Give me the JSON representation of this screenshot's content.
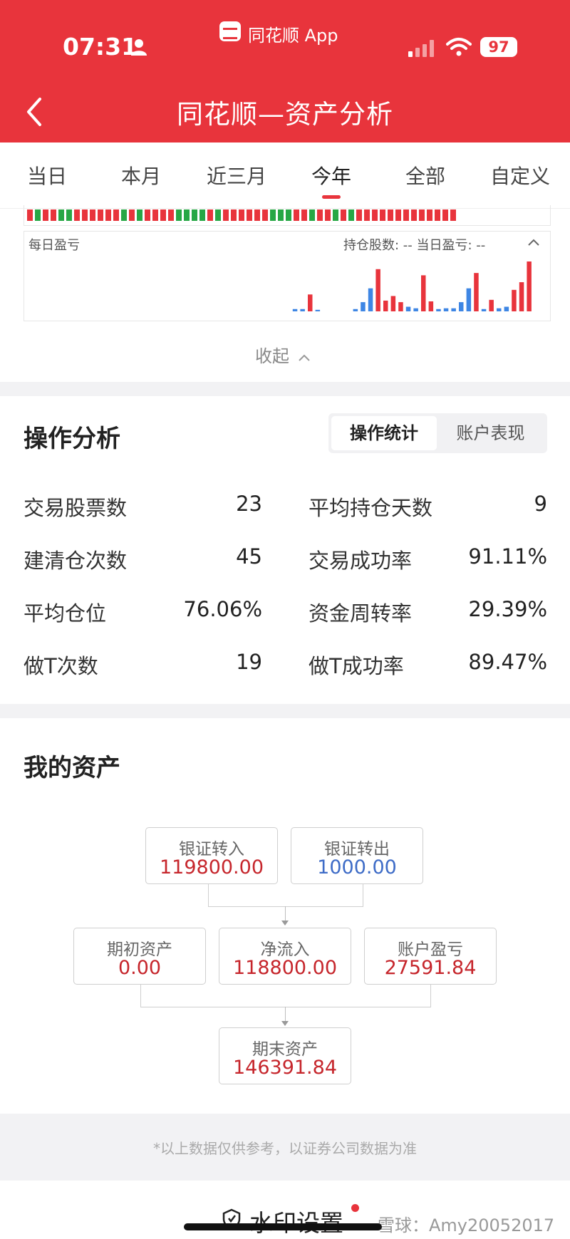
{
  "status_bar": {
    "time": "07:31",
    "app_name": "同花顺 App",
    "battery": "97"
  },
  "header": {
    "title": "同花顺—资产分析"
  },
  "tabs": [
    {
      "label": "当日"
    },
    {
      "label": "本月"
    },
    {
      "label": "近三月"
    },
    {
      "label": "今年"
    },
    {
      "label": "全部"
    },
    {
      "label": "自定义"
    }
  ],
  "active_tab": "今年",
  "daily_chart": {
    "label": "每日盈亏",
    "info": "持仓股数: -- 当日盈亏: --",
    "collapse": "收起",
    "colors": {
      "profit": "#e8343c",
      "loss": "#3e86e4",
      "strip_down": "#27a745"
    }
  },
  "chart_data": {
    "type": "bar",
    "values": [
      0,
      0,
      0,
      0,
      0,
      0,
      0,
      0,
      0,
      0,
      0,
      0,
      0,
      0,
      0,
      0,
      0,
      0,
      -3,
      -3,
      22,
      -2,
      0,
      0,
      0,
      0,
      -3,
      -12,
      -30,
      55,
      14,
      20,
      12,
      -6,
      -4,
      47,
      13,
      -3,
      -4,
      -4,
      -12,
      -30,
      50,
      -3,
      15,
      -4,
      -6,
      28,
      38,
      65
    ]
  },
  "operation_analysis": {
    "title": "操作分析",
    "segments": [
      {
        "label": "操作统计"
      },
      {
        "label": "账户表现"
      }
    ],
    "stats": [
      {
        "label": "交易股票数",
        "value": "23"
      },
      {
        "label": "平均持仓天数",
        "value": "9"
      },
      {
        "label": "建清仓次数",
        "value": "45"
      },
      {
        "label": "交易成功率",
        "value": "91.11%"
      },
      {
        "label": "平均仓位",
        "value": "76.06%"
      },
      {
        "label": "资金周转率",
        "value": "29.39%"
      },
      {
        "label": "做T次数",
        "value": "19"
      },
      {
        "label": "做T成功率",
        "value": "89.47%"
      }
    ]
  },
  "my_assets": {
    "title": "我的资产",
    "bank_in": {
      "label": "银证转入",
      "value": "119800.00"
    },
    "bank_out": {
      "label": "银证转出",
      "value": "1000.00"
    },
    "initial": {
      "label": "期初资产",
      "value": "0.00"
    },
    "net_inflow": {
      "label": "净流入",
      "value": "118800.00"
    },
    "pnl": {
      "label": "账户盈亏",
      "value": "27591.84"
    },
    "final": {
      "label": "期末资产",
      "value": "146391.84"
    }
  },
  "footer": {
    "disclaimer": "*以上数据仅供参考，以证券公司数据为准",
    "watermark_setting": "水印设置",
    "source_credit": "雪球：Amy20052017"
  }
}
